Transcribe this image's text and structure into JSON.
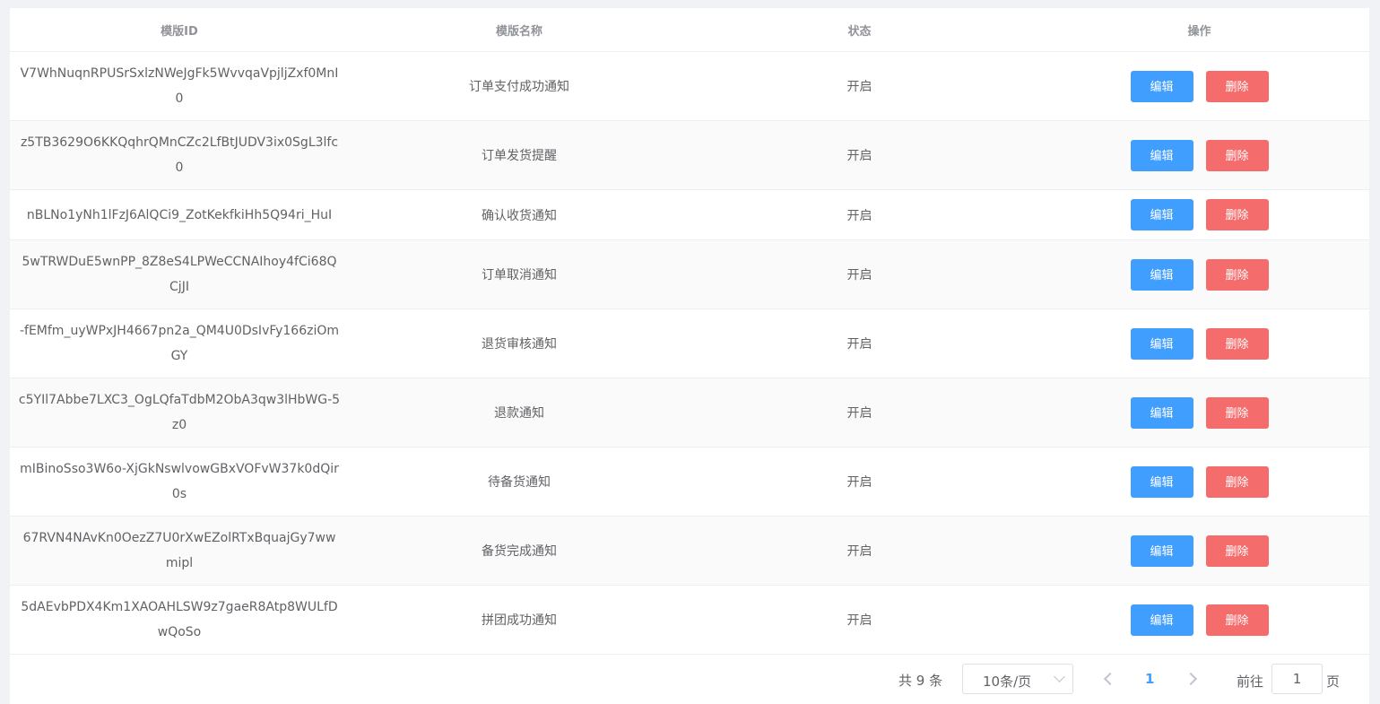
{
  "table": {
    "columns": [
      "模版ID",
      "模版名称",
      "状态",
      "操作"
    ],
    "rows": [
      {
        "id": "V7WhNuqnRPUSrSxlzNWeJgFk5WvvqaVpjljZxf0MnI0",
        "name": "订单支付成功通知",
        "status": "开启"
      },
      {
        "id": "z5TB3629O6KKQqhrQMnCZc2LfBtJUDV3ix0SgL3lfc0",
        "name": "订单发货提醒",
        "status": "开启"
      },
      {
        "id": "nBLNo1yNh1lFzJ6AlQCi9_ZotKekfkiHh5Q94ri_HuI",
        "name": "确认收货通知",
        "status": "开启"
      },
      {
        "id": "5wTRWDuE5wnPP_8Z8eS4LPWeCCNAIhoy4fCi68QCjJI",
        "name": "订单取消通知",
        "status": "开启"
      },
      {
        "id": "-fEMfm_uyWPxJH4667pn2a_QM4U0DsIvFy166ziOmGY",
        "name": "退货审核通知",
        "status": "开启"
      },
      {
        "id": "c5YIl7Abbe7LXC3_OgLQfaTdbM2ObA3qw3lHbWG-5z0",
        "name": "退款通知",
        "status": "开启"
      },
      {
        "id": "mIBinoSso3W6o-XjGkNswlvowGBxVOFvW37k0dQir0s",
        "name": "待备货通知",
        "status": "开启"
      },
      {
        "id": "67RVN4NAvKn0OezZ7U0rXwEZolRTxBquajGy7wwmipl",
        "name": "备货完成通知",
        "status": "开启"
      },
      {
        "id": "5dAEvbPDX4Km1XAOAHLSW9z7gaeR8Atp8WULfDwQoSo",
        "name": "拼团成功通知",
        "status": "开启"
      }
    ],
    "edit_label": "编辑",
    "delete_label": "删除"
  },
  "pagination": {
    "total_text": "共 9 条",
    "page_size": "10条/页",
    "current_page": "1",
    "goto_label": "前往",
    "goto_value": "1",
    "page_unit": "页"
  },
  "colors": {
    "primary": "#409eff",
    "danger": "#f56c6c"
  }
}
